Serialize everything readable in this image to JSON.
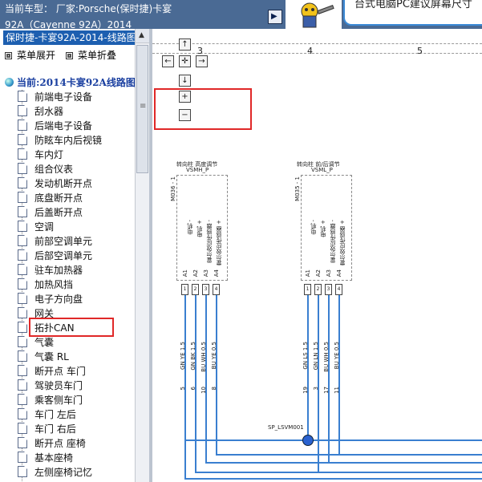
{
  "header": {
    "car_label": "当前车型：  厂家:Porsche(保时捷)卡宴",
    "car_line2": "92A（Cayenne 92A）2014",
    "ad_text": "台式电脑PC建议屏幕尺寸"
  },
  "sidebar": {
    "title": "保时捷-卡宴92A-2014-线路图",
    "expand_label": "菜单展开",
    "collapse_label": "菜单折叠",
    "current_label": "当前:2014卡宴92A线路图",
    "items": [
      {
        "label": "前端电子设备"
      },
      {
        "label": "刮水器"
      },
      {
        "label": "后端电子设备"
      },
      {
        "label": "防眩车内后视镜"
      },
      {
        "label": "车内灯"
      },
      {
        "label": "组合仪表"
      },
      {
        "label": "发动机断开点"
      },
      {
        "label": "底盘断开点"
      },
      {
        "label": "后盖断开点"
      },
      {
        "label": "空调"
      },
      {
        "label": "前部空调单元"
      },
      {
        "label": "后部空调单元"
      },
      {
        "label": "驻车加热器"
      },
      {
        "label": "加热风挡"
      },
      {
        "label": "电子方向盘"
      },
      {
        "label": "网关"
      },
      {
        "label": "拓扑CAN"
      },
      {
        "label": "气囊"
      },
      {
        "label": "气囊 RL"
      },
      {
        "label": "断开点 车门"
      },
      {
        "label": "驾驶员车门"
      },
      {
        "label": "乘客侧车门"
      },
      {
        "label": "车门 左后"
      },
      {
        "label": "车门 右后"
      },
      {
        "label": "断开点 座椅"
      },
      {
        "label": "基本座椅"
      },
      {
        "label": "左侧座椅记忆"
      }
    ],
    "selected_index": 14
  },
  "diagram": {
    "columns": [
      "3",
      "4",
      "5"
    ],
    "nav": {
      "up": "↑",
      "left": "←",
      "center": "✛",
      "right": "→",
      "down": "↓",
      "zoom_in": "+",
      "zoom_out": "−"
    },
    "components": [
      {
        "title": "转向柱 高度调节",
        "code": "VSMH_P",
        "id": "M036 - 1",
        "pin_labels": [
          "电机 -",
          "电机 +",
          "霍尔效应传感器 -",
          "霍尔效应传感器 +"
        ],
        "pins": [
          "A1",
          "A2",
          "A3",
          "A4"
        ],
        "terminals": [
          "1",
          "2",
          "3",
          "4"
        ],
        "wires": [
          "GN YE 1.5",
          "GN BK 1.5",
          "BU WH 0.5",
          "BU YE 0.5"
        ],
        "wire_nums": [
          "5",
          "6",
          "10",
          "8"
        ]
      },
      {
        "title": "转向柱 前/后调节",
        "code": "VSML_P",
        "id": "M035 - 1",
        "pin_labels": [
          "电机 -",
          "电机 +",
          "霍尔效应传感器 -",
          "霍尔效应传感器 +"
        ],
        "pins": [
          "A1",
          "A2",
          "A3",
          "A4"
        ],
        "terminals": [
          "1",
          "2",
          "3",
          "4"
        ],
        "wires": [
          "GN LS 1.5",
          "GN LN 1.5",
          "BU WH 0.5",
          "BU YE 0.5"
        ],
        "wire_nums": [
          "19",
          "3",
          "17",
          "11"
        ]
      }
    ],
    "splice": "SP_LSVM001",
    "wire_color": "#3a7fd0",
    "highlight_color": "#e02828"
  }
}
